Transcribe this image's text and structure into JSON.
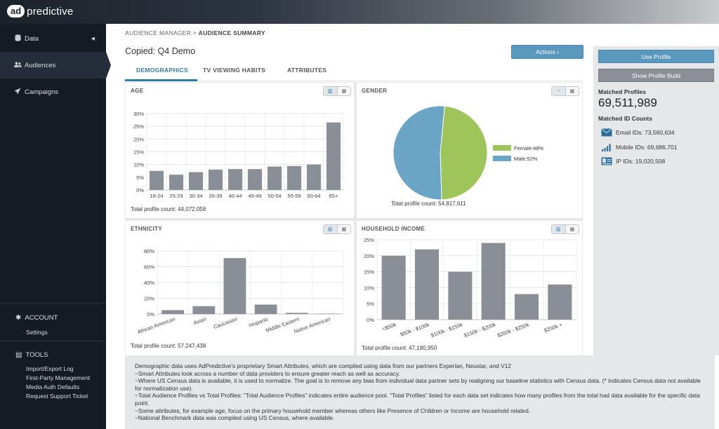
{
  "app": {
    "logo_badge": "ad",
    "logo_text": "predictive"
  },
  "sidebar": {
    "items": [
      {
        "label": "Data",
        "icon": "database-icon"
      },
      {
        "label": "Audiences",
        "icon": "users-icon"
      },
      {
        "label": "Campaigns",
        "icon": "paper-plane-icon"
      }
    ],
    "account": {
      "title": "ACCOUNT",
      "items": [
        "Settings"
      ]
    },
    "tools": {
      "title": "TOOLS",
      "items": [
        "Import/Export Log",
        "First-Party Management",
        "Media Auth Defaults",
        "Request Support Ticket"
      ]
    }
  },
  "breadcrumb": {
    "parent": "AUDIENCE MANAGER >",
    "current": "AUDIENCE SUMMARY"
  },
  "page_title": "Copied: Q4 Demo",
  "actions_label": "Actions ›",
  "tabs": [
    "DEMOGRAPHICS",
    "TV VIEWING HABITS",
    "ATTRIBUTES"
  ],
  "panels": {
    "age": {
      "title": "AGE",
      "total": "Total profile count: 44,072,058"
    },
    "gender": {
      "title": "GENDER",
      "total": "Total profile count: 54,817,611"
    },
    "ethnicity": {
      "title": "ETHNICITY",
      "total": "Total profile count: 57,247,438"
    },
    "income": {
      "title": "HOUSEHOLD INCOME",
      "total": "Total profile count: 47,180,950"
    }
  },
  "chart_data": [
    {
      "type": "bar",
      "title": "AGE",
      "categories": [
        "18-24",
        "25-29",
        "30-34",
        "35-39",
        "40-44",
        "45-49",
        "50-54",
        "55-59",
        "60-64",
        "65+"
      ],
      "values": [
        7.5,
        6,
        7,
        8,
        8.2,
        8.2,
        9.2,
        9.4,
        10,
        26.5
      ],
      "yticks": [
        "0%",
        "5%",
        "10%",
        "15%",
        "20%",
        "25%",
        "30%"
      ],
      "ylim": [
        0,
        30
      ],
      "grid": true
    },
    {
      "type": "pie",
      "title": "GENDER",
      "categories": [
        "Female",
        "Male"
      ],
      "values": [
        48,
        52
      ],
      "labels": [
        "Female:48%",
        "Male:52%"
      ],
      "colors": [
        "#9dc55a",
        "#6aa5c6"
      ],
      "legend": "right"
    },
    {
      "type": "bar",
      "title": "ETHNICITY",
      "categories": [
        "African American",
        "Asian",
        "Caucasian",
        "Hispanic",
        "Middle Eastern",
        "Native American"
      ],
      "values": [
        5,
        10,
        71,
        12,
        1.5,
        0.5
      ],
      "yticks": [
        "0%",
        "20%",
        "40%",
        "60%",
        "80%"
      ],
      "ylim": [
        0,
        80
      ],
      "grid": true
    },
    {
      "type": "bar",
      "title": "HOUSEHOLD INCOME",
      "categories": [
        "<$50k",
        "$50k - $100k",
        "$100k - $150k",
        "$150k - $200k",
        "$200k - $250k",
        "$250k +"
      ],
      "values": [
        20,
        22,
        15,
        24,
        8,
        11
      ],
      "yticks": [
        "0%",
        "5%",
        "10%",
        "15%",
        "20%",
        "25%"
      ],
      "ylim": [
        0,
        25
      ],
      "grid": true
    }
  ],
  "right": {
    "use_profile": "Use Profile",
    "show_build": "Show Profile Build",
    "matched_profiles_label": "Matched Profiles",
    "matched_profiles_value": "69,511,989",
    "matched_id_label": "Matched ID Counts",
    "ids": [
      {
        "label": "Email IDs: 73,560,634",
        "icon": "envelope-icon"
      },
      {
        "label": "Mobile IDs: 69,686,701",
        "icon": "signal-bars-icon"
      },
      {
        "label": "IP IDs: 19,020,508",
        "icon": "id-card-icon"
      }
    ]
  },
  "notes": [
    "Demographic data uses AdPredictive's proprietary Smart Attributes, which are compiled using data from our partners Experian, Neustar, and V12",
    "~Smart Attributes look across a number of data providers to ensure greater reach as well as accuracy.",
    "~Where US Census data is available, it is used to normalize. The goal is to remove any bias from individual data partner sets by realigning our baseline statistics with Census data. (* indicates Census data not available for normalization use).",
    "~Total Audience Profiles vs Total Profiles: “Total Audience Profiles” indicates entire audience pool. “Total Profiles” listed for each data set indicates how many profiles from the total had data available for the specific data point.",
    "~Some attributes, for example age, focus on the primary household member whereas others like Presence of Children or Income are household related.",
    "~National Benchmark data was compiled using US Census, where available."
  ],
  "colors": {
    "bar": "#8a8e96",
    "accent": "#5a98be",
    "tab_active": "#2f7ca6",
    "sidebar": "#141b25"
  }
}
